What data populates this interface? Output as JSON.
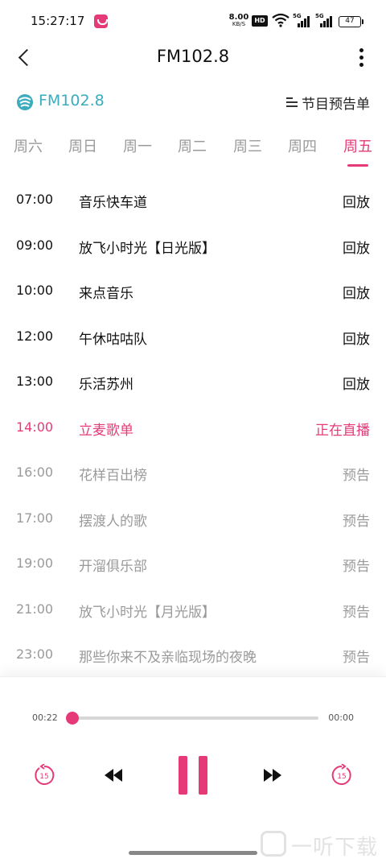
{
  "status_bar": {
    "time": "15:27:17",
    "net_speed_value": "8.00",
    "net_speed_unit": "KB/S",
    "hd_badge": "HD",
    "signal1_tag": "5G",
    "signal2_tag": "5G",
    "battery": "47"
  },
  "nav": {
    "title": "FM102.8"
  },
  "station": {
    "name": "FM102.8",
    "schedule_label": "节目预告单"
  },
  "day_tabs": [
    "周六",
    "周日",
    "周一",
    "周二",
    "周三",
    "周四",
    "周五"
  ],
  "active_day": "周五",
  "programs": [
    {
      "time": "07:00",
      "name": "音乐快车道",
      "action": "回放",
      "state": "past"
    },
    {
      "time": "09:00",
      "name": "放飞小时光【日光版】",
      "action": "回放",
      "state": "past"
    },
    {
      "time": "10:00",
      "name": "来点音乐",
      "action": "回放",
      "state": "past"
    },
    {
      "time": "12:00",
      "name": "午休咕咕队",
      "action": "回放",
      "state": "past"
    },
    {
      "time": "13:00",
      "name": "乐活苏州",
      "action": "回放",
      "state": "past"
    },
    {
      "time": "14:00",
      "name": "立麦歌单",
      "action": "正在直播",
      "state": "live"
    },
    {
      "time": "16:00",
      "name": "花样百出榜",
      "action": "预告",
      "state": "future"
    },
    {
      "time": "17:00",
      "name": "摆渡人的歌",
      "action": "预告",
      "state": "future"
    },
    {
      "time": "19:00",
      "name": "开溜俱乐部",
      "action": "预告",
      "state": "future"
    },
    {
      "time": "21:00",
      "name": "放飞小时光【月光版】",
      "action": "预告",
      "state": "future"
    },
    {
      "time": "23:00",
      "name": "那些你来不及亲临现场的夜晚",
      "action": "预告",
      "state": "future"
    }
  ],
  "player": {
    "current_time": "00:22",
    "total_time": "00:00",
    "progress_fraction": 0.0,
    "rewind_seconds": "15",
    "forward_seconds": "15"
  },
  "watermark": {
    "text": "一听下载"
  },
  "colors": {
    "accent": "#e63a78",
    "station": "#3aacbe",
    "muted": "#9a9a9a"
  }
}
